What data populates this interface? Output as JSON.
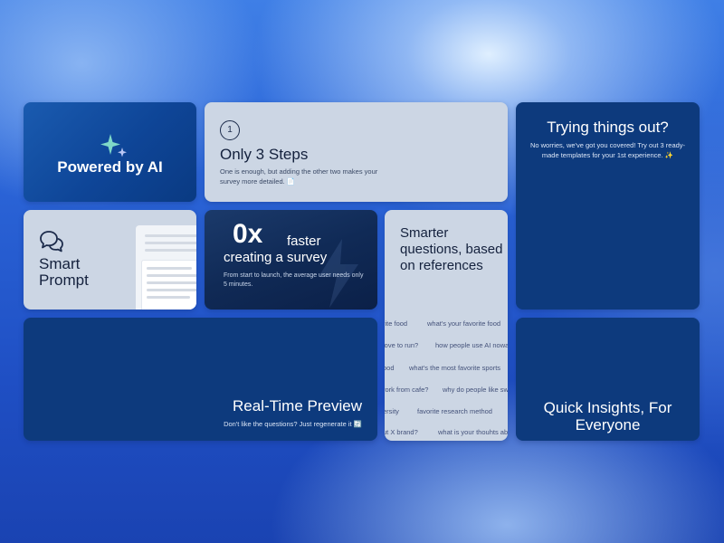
{
  "cards": {
    "powered_by_ai": {
      "title": "Powered by AI",
      "icon": "sparkle-icon"
    },
    "only_3_steps": {
      "step_number": "1",
      "title": "Only 3 Steps",
      "description": "One is enough, but adding the other two makes your survey more detailed. 📄"
    },
    "trying_things_out": {
      "title": "Trying things out?",
      "description": "No worries, we've got you covered! Try out 3 ready-made templates for your 1st experience. ✨"
    },
    "smart_prompt": {
      "title": "Smart Prompt",
      "icon": "chat-bubbles-icon"
    },
    "faster": {
      "big": "0x",
      "faster": "faster",
      "creating": "creating a survey",
      "description": "From start to launch, the average user needs only 5 minutes."
    },
    "smarter_questions": {
      "title": "Smarter questions, based on references",
      "tags": [
        "rite food",
        "what's your favorite food",
        "love to run?",
        "how people use AI nowa",
        "ood",
        "what's the most favorite sports",
        "rork from cafe?",
        "why do people like sw",
        "ersity",
        "favorite research method",
        "ut X brand?",
        "what is your thouhts ab"
      ]
    },
    "real_time_preview": {
      "title": "Real-Time Preview",
      "description": "Don't like the questions? Just regenerate it 🔄"
    },
    "quick_insights": {
      "title": "Quick Insights, For Everyone"
    }
  },
  "colors": {
    "navy": "#0d3a7d",
    "light_card": "#ccd6e4",
    "background": "#2a63d6"
  }
}
